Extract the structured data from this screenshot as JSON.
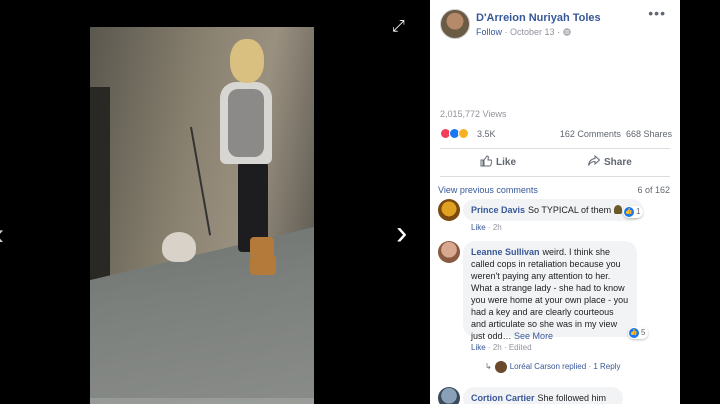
{
  "post": {
    "author": "D'Arreion Nuriyah Toles",
    "follow_label": "Follow",
    "date": "October 13",
    "more": "•••",
    "views": "2,015,772 Views",
    "reaction_count": "3.5K",
    "comments_count": "162 Comments",
    "shares_count": "668 Shares",
    "like_label": "Like",
    "share_label": "Share"
  },
  "comments_header": {
    "view_previous": "View previous comments",
    "pager": "6 of 162"
  },
  "comments": [
    {
      "author": "Prince Davis",
      "text": "So TYPICAL of them",
      "reactions": "1",
      "like": "Like",
      "time": "2h"
    },
    {
      "author": "Leanne Sullivan",
      "lines": [
        "weird. I think she",
        "called cops in retaliation because you",
        "weren't paying any attention to her.",
        "What a strange lady - she had to know",
        "you were home at your own place - you",
        "had a key and are clearly courteous",
        "and articulate so she was in my view",
        "just odd…"
      ],
      "see_more": "See More",
      "reactions": "5",
      "like": "Like",
      "time": "2h",
      "edited": "Edited",
      "reply_text": "Loréal Carson replied",
      "reply_count": "1 Reply"
    },
    {
      "author": "Cortion Cartier",
      "text": "She followed him"
    }
  ],
  "icons": {
    "expand": "expand-icon",
    "prev": "chevron-left-icon",
    "next": "chevron-right-icon",
    "like": "thumbs-up-icon",
    "share": "share-arrow-icon",
    "globe": "globe-icon"
  },
  "colors": {
    "link": "#365899",
    "reaction_like": "#1877f2",
    "reaction_love": "#f33e58",
    "reaction_haha": "#f7b125"
  }
}
